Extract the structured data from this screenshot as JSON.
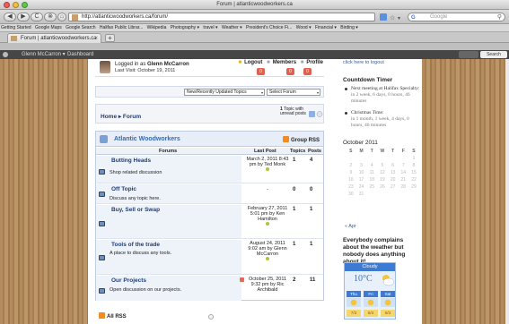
{
  "browser": {
    "window_title": "Forum | atlanticwoodworkers.ca",
    "url": "http://atlanticwoodworkers.ca/forum/",
    "search_placeholder": "Google",
    "search_engine_icon": "google-g-icon",
    "tab_title": "Forum | atlanticwoodworkers.ca",
    "tab_close": "×",
    "new_tab": "+",
    "nav_glyphs": {
      "back": "◀",
      "forward": "▶",
      "reload": "C",
      "stop": "⊗",
      "home": "⌂",
      "wrench": "✎"
    },
    "bookmarks": [
      "Getting Started",
      "Google Maps",
      "Google Search",
      "Halifax Public Librar...",
      "Wikipedia",
      "Photography ▾",
      "travel ▾",
      "Weather ▾",
      "President's Choice Fi...",
      "Wood ▾",
      "Financial ▾",
      "Birding ▾"
    ]
  },
  "admin_bar": {
    "user": "Glenn McCarron ▾",
    "dashboard": "Dashboard",
    "search_button": "Search"
  },
  "forum_user": {
    "logged_in_prefix": "Logged in as",
    "user_name": "Glenn McCarron",
    "last_visit": "Last Visit: October 19, 2011",
    "links": {
      "logout": "Logout",
      "members": "Members",
      "profile": "Profile"
    },
    "badges": [
      "0",
      "0",
      "0"
    ]
  },
  "topic_bar": {
    "selected_topics": "New/Recently Updated Topics",
    "select_forum": "Select Forum",
    "arrow": "▾"
  },
  "breadcrumb": {
    "text": "Home ▸ Forum",
    "unread_count": "1",
    "unread_text_1": "Topic with",
    "unread_text_2": "unread posts"
  },
  "forum_group": {
    "title": "Atlantic Woodworkers",
    "group_rss": "Group RSS",
    "columns": {
      "forums": "Forums",
      "last_post": "Last Post",
      "topics": "Topics",
      "posts": "Posts"
    },
    "rows": [
      {
        "name": "Butting Heads",
        "desc": "Shop related discussion",
        "last_post": "March 2, 2011 8:43 pm by Ted Monk",
        "topics": "1",
        "posts": "4"
      },
      {
        "name": "Off Topic",
        "desc": "Discuss any topic here.",
        "last_post": "-",
        "topics": "0",
        "posts": "0"
      },
      {
        "name": "Buy, Sell or Swap",
        "desc": "",
        "last_post": "February 27, 2011 5:01 pm by Ken Hamilton",
        "topics": "1",
        "posts": "1"
      },
      {
        "name": "Tools of the trade",
        "desc": "A place to discuss any tools.",
        "last_post": "August 24, 2011 9:02 am by Glenn McCarron",
        "topics": "1",
        "posts": "1"
      },
      {
        "name": "Our Projects",
        "desc": "Open discussion on our projects.",
        "last_post": "October 25, 2011 9:32 pm by Ric Archibald",
        "topics": "2",
        "posts": "11"
      }
    ]
  },
  "all_rss": "All RSS",
  "sidebar": {
    "logout_link": "click here to logout",
    "countdown_title": "Countdown Timer",
    "countdown": [
      {
        "text": "Next meeting at Halifax Specialty:",
        "sub": "in 2 week, 6 days, 0 hours, 46 minutes"
      },
      {
        "text": "Christmas Time:",
        "sub": "in 1 month, 1 week, 4 days, 0 hours, 46 minutes"
      }
    ],
    "calendar_title": "October 2011",
    "calendar_days": [
      "S",
      "M",
      "T",
      "W",
      "T",
      "F",
      "S"
    ],
    "calendar_weeks": [
      [
        "",
        "",
        "",
        "",
        "",
        "",
        "1"
      ],
      [
        "2",
        "3",
        "4",
        "5",
        "6",
        "7",
        "8"
      ],
      [
        "9",
        "10",
        "11",
        "12",
        "13",
        "14",
        "15"
      ],
      [
        "16",
        "17",
        "18",
        "19",
        "20",
        "21",
        "22"
      ],
      [
        "23",
        "24",
        "25",
        "26",
        "27",
        "28",
        "29"
      ],
      [
        "30",
        "31",
        "",
        "",
        "",
        "",
        ""
      ]
    ],
    "calendar_prev": "« Apr",
    "quote": "Everybody complains about the weather but nobody does anything about it!",
    "weather": {
      "condition": "Cloudy",
      "temp": "10°C",
      "days": [
        "Thu",
        "Fri",
        "Sat"
      ],
      "hilo": [
        "7/3",
        "6/4",
        "6/3"
      ]
    }
  },
  "colors": {
    "accent": "#3569b5",
    "link": "#1f3e74",
    "wood": "#b38b5c",
    "admin_bar": "#464646"
  }
}
